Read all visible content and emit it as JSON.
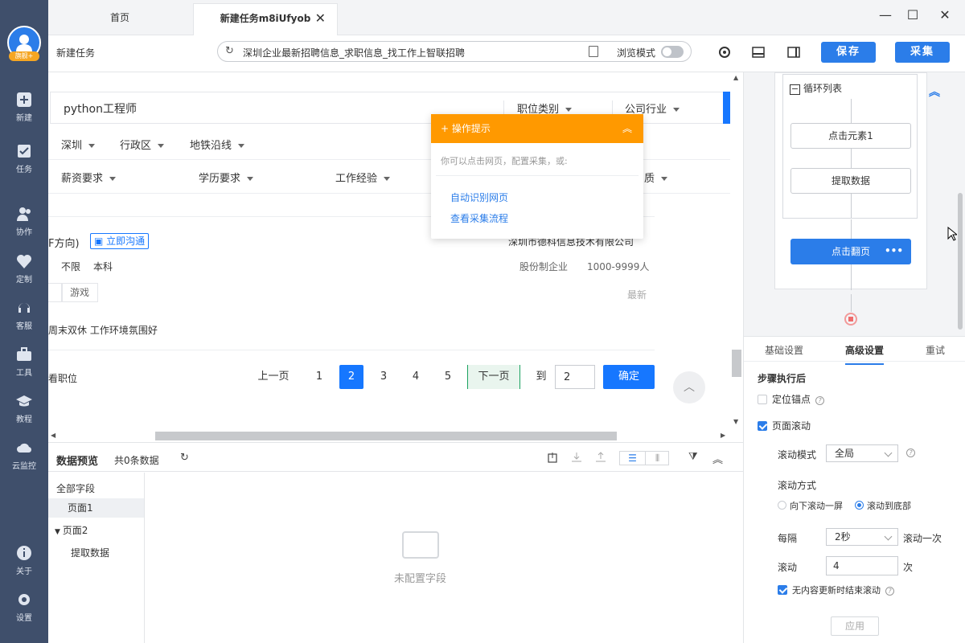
{
  "rail": {
    "logo_tag": "旗舰+",
    "items": [
      {
        "label": "新建",
        "icon": "plus-square-icon"
      },
      {
        "label": "任务",
        "icon": "task-flag-icon"
      },
      {
        "label": "协作",
        "icon": "users-icon"
      },
      {
        "label": "定制",
        "icon": "heart-shield-icon"
      },
      {
        "label": "客服",
        "icon": "headset-icon"
      },
      {
        "label": "工具",
        "icon": "toolbox-icon"
      },
      {
        "label": "教程",
        "icon": "graduation-cap-icon"
      },
      {
        "label": "云监控",
        "icon": "cloud-monitor-icon"
      },
      {
        "label": "关于",
        "icon": "info-icon"
      },
      {
        "label": "设置",
        "icon": "gear-icon"
      }
    ]
  },
  "tabs": {
    "home": "首页",
    "task": "新建任务m8iUfyob",
    "close": "✕"
  },
  "toolbar": {
    "task_name": "新建任务",
    "url": "深圳企业最新招聘信息_求职信息_找工作上智联招聘",
    "browse_mode": "浏览模式",
    "save": "保存",
    "collect": "采集"
  },
  "page": {
    "search_query": "python工程师",
    "dropdowns": [
      "职位类别",
      "公司行业"
    ],
    "filters_row1": [
      "深圳",
      "行政区",
      "地铁沿线"
    ],
    "filters_row2": [
      "薪资要求",
      "学历要求",
      "工作经验",
      "质"
    ],
    "job": {
      "title_fragment": "F方向)",
      "chat_label": "立即沟通",
      "company": "深圳市德科信息技术有限公司",
      "req1": "不限",
      "req2": "本科",
      "company_type": "股份制企业",
      "company_size": "1000-9999人",
      "tag": "游戏",
      "time": "最新",
      "welfare": "周末双休 工作环境氛围好"
    },
    "footer_left": "看职位",
    "pager": {
      "prev": "上一页",
      "pages": [
        "1",
        "2",
        "3",
        "4",
        "5"
      ],
      "active": "2",
      "next": "下一页",
      "goto_label": "到",
      "goto_value": "2",
      "confirm": "确定"
    }
  },
  "tip": {
    "title": "操作提示",
    "hint": "你可以点击网页，配置采集，或:",
    "links": [
      "自动识别网页",
      "查看采集流程"
    ]
  },
  "preview": {
    "title": "数据预览",
    "count": "共0条数据",
    "tree": [
      "全部字段",
      "页面1",
      "页面2",
      "提取数据"
    ],
    "empty_text": "未配置字段"
  },
  "workflow": {
    "loop_label": "循环列表",
    "nodes": [
      "点击元素1",
      "提取数据"
    ],
    "page_node": "点击翻页",
    "more": "•••"
  },
  "settings": {
    "tabs": [
      "基础设置",
      "高级设置",
      "重试"
    ],
    "active_tab": "高级设置",
    "section_title": "步骤执行后",
    "anchor_label": "定位锚点",
    "scroll_label": "页面滚动",
    "scroll_mode_label": "滚动模式",
    "scroll_mode_value": "全局",
    "scroll_way_label": "滚动方式",
    "scroll_options": [
      "向下滚动一屏",
      "滚动到底部"
    ],
    "every_label": "每隔",
    "every_value": "2秒",
    "every_suffix": "滚动一次",
    "times_label": "滚动",
    "times_value": "4",
    "times_suffix": "次",
    "stop_label": "无内容更新时结束滚动",
    "apply": "应用"
  },
  "colors": {
    "rail": "#3f4f6b",
    "primary": "#2b7de9",
    "tip_header": "#ff9900"
  }
}
